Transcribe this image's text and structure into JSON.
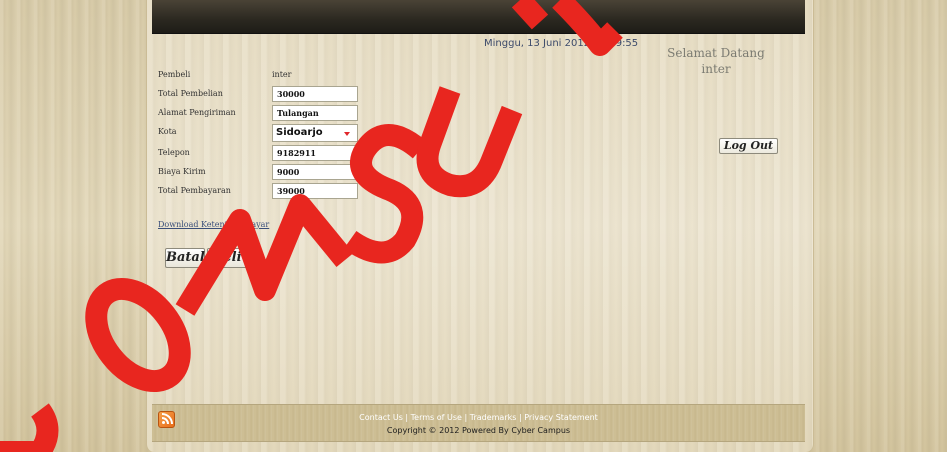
{
  "header": {
    "datetime": "Minggu, 13 Juni 2012 14:59:55",
    "welcome_line1": "Selamat Datang",
    "welcome_line2": "inter",
    "logout_label": "Log Out"
  },
  "form": {
    "pembeli": {
      "label": "Pembeli",
      "value": "inter"
    },
    "total_pembelian": {
      "label": "Total Pembelian",
      "value": "30000"
    },
    "alamat": {
      "label": "Alamat Pengiriman",
      "value": "Tulangan"
    },
    "kota": {
      "label": "Kota",
      "value": "Sidoarjo"
    },
    "telepon": {
      "label": "Telepon",
      "value": "9182911"
    },
    "biaya_kirim": {
      "label": "Biaya Kirim",
      "value": "9000"
    },
    "total_pembayaran": {
      "label": "Total Pembayaran",
      "value": "39000"
    }
  },
  "download_link": "Download Ketentuan Bayar",
  "buttons": {
    "batal": "Batal",
    "beli": "Beli"
  },
  "footer": {
    "links": "Contact Us | Terms of Use | Trademarks | Privacy Statement",
    "copyright": "Copyright © 2012 Powered By Cyber Campus"
  },
  "colors": {
    "watermark": "#e8261f",
    "rss": "#f08a2e"
  },
  "watermark_text": "DOKUMEN KOMSURABAYA"
}
